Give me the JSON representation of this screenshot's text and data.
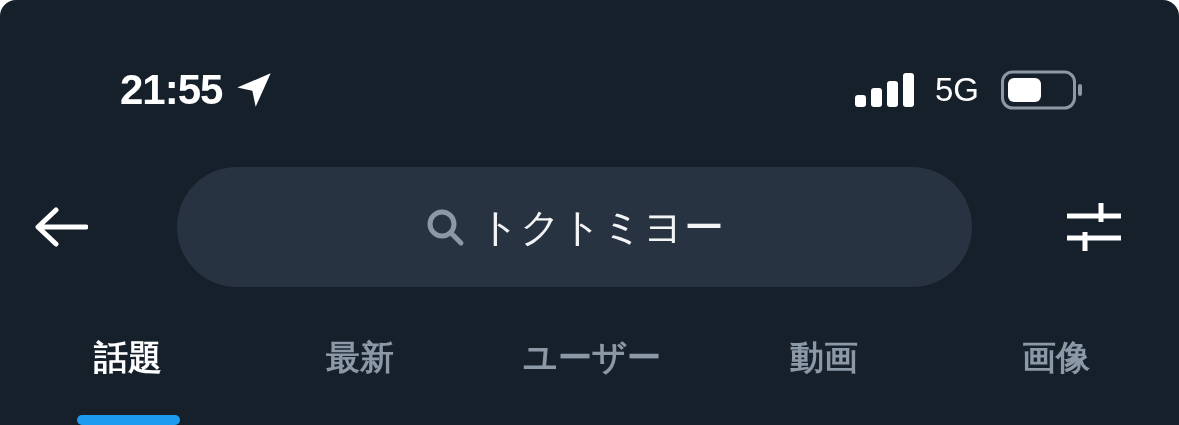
{
  "status_bar": {
    "time": "21:55",
    "network": "5G"
  },
  "search": {
    "value": "トクトミヨー"
  },
  "tabs": [
    {
      "label": "話題",
      "selected": true
    },
    {
      "label": "最新",
      "selected": false
    },
    {
      "label": "ユーザー",
      "selected": false
    },
    {
      "label": "動画",
      "selected": false
    },
    {
      "label": "画像",
      "selected": false
    }
  ]
}
